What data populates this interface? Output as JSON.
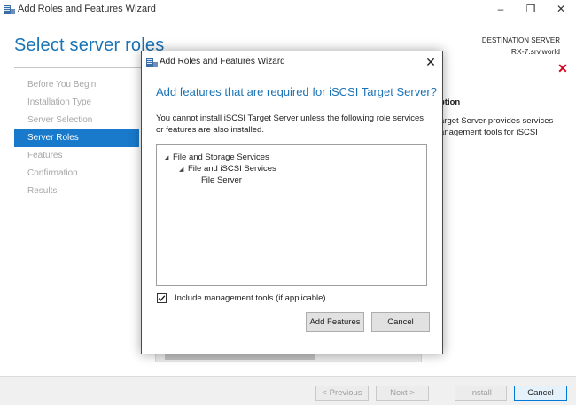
{
  "window": {
    "title": "Add Roles and Features Wizard",
    "controls": {
      "minimize": "–",
      "maximize": "❐",
      "close": "✕"
    }
  },
  "page": {
    "title": "Select server roles",
    "destination_label": "DESTINATION SERVER",
    "destination_server": "RX-7.srv.world",
    "error_icon": "✕"
  },
  "nav": {
    "items": [
      {
        "label": "Before You Begin",
        "active": false
      },
      {
        "label": "Installation Type",
        "active": false
      },
      {
        "label": "Server Selection",
        "active": false
      },
      {
        "label": "Server Roles",
        "active": true
      },
      {
        "label": "Features",
        "active": false
      },
      {
        "label": "Confirmation",
        "active": false
      },
      {
        "label": "Results",
        "active": false
      }
    ]
  },
  "description": {
    "heading": "ption",
    "text": "arget Server provides services anagement tools for iSCSI"
  },
  "footer": {
    "previous": "< Previous",
    "next": "Next >",
    "install": "Install",
    "cancel": "Cancel"
  },
  "dialog": {
    "title": "Add Roles and Features Wizard",
    "close": "✕",
    "heading": "Add features that are required for iSCSI Target Server?",
    "message": "You cannot install iSCSI Target Server unless the following role services or features are also installed.",
    "tree": [
      {
        "label": "File and Storage Services",
        "expanded": true
      },
      {
        "label": "File and iSCSI Services",
        "expanded": true
      },
      {
        "label": "File Server",
        "expanded": false
      }
    ],
    "include_tools_label": "Include management tools (if applicable)",
    "include_tools_checked": true,
    "add_features": "Add Features",
    "cancel": "Cancel"
  },
  "colors": {
    "accent": "#1979ca",
    "heading_blue": "#1a73b5",
    "error_red": "#d6001c"
  }
}
